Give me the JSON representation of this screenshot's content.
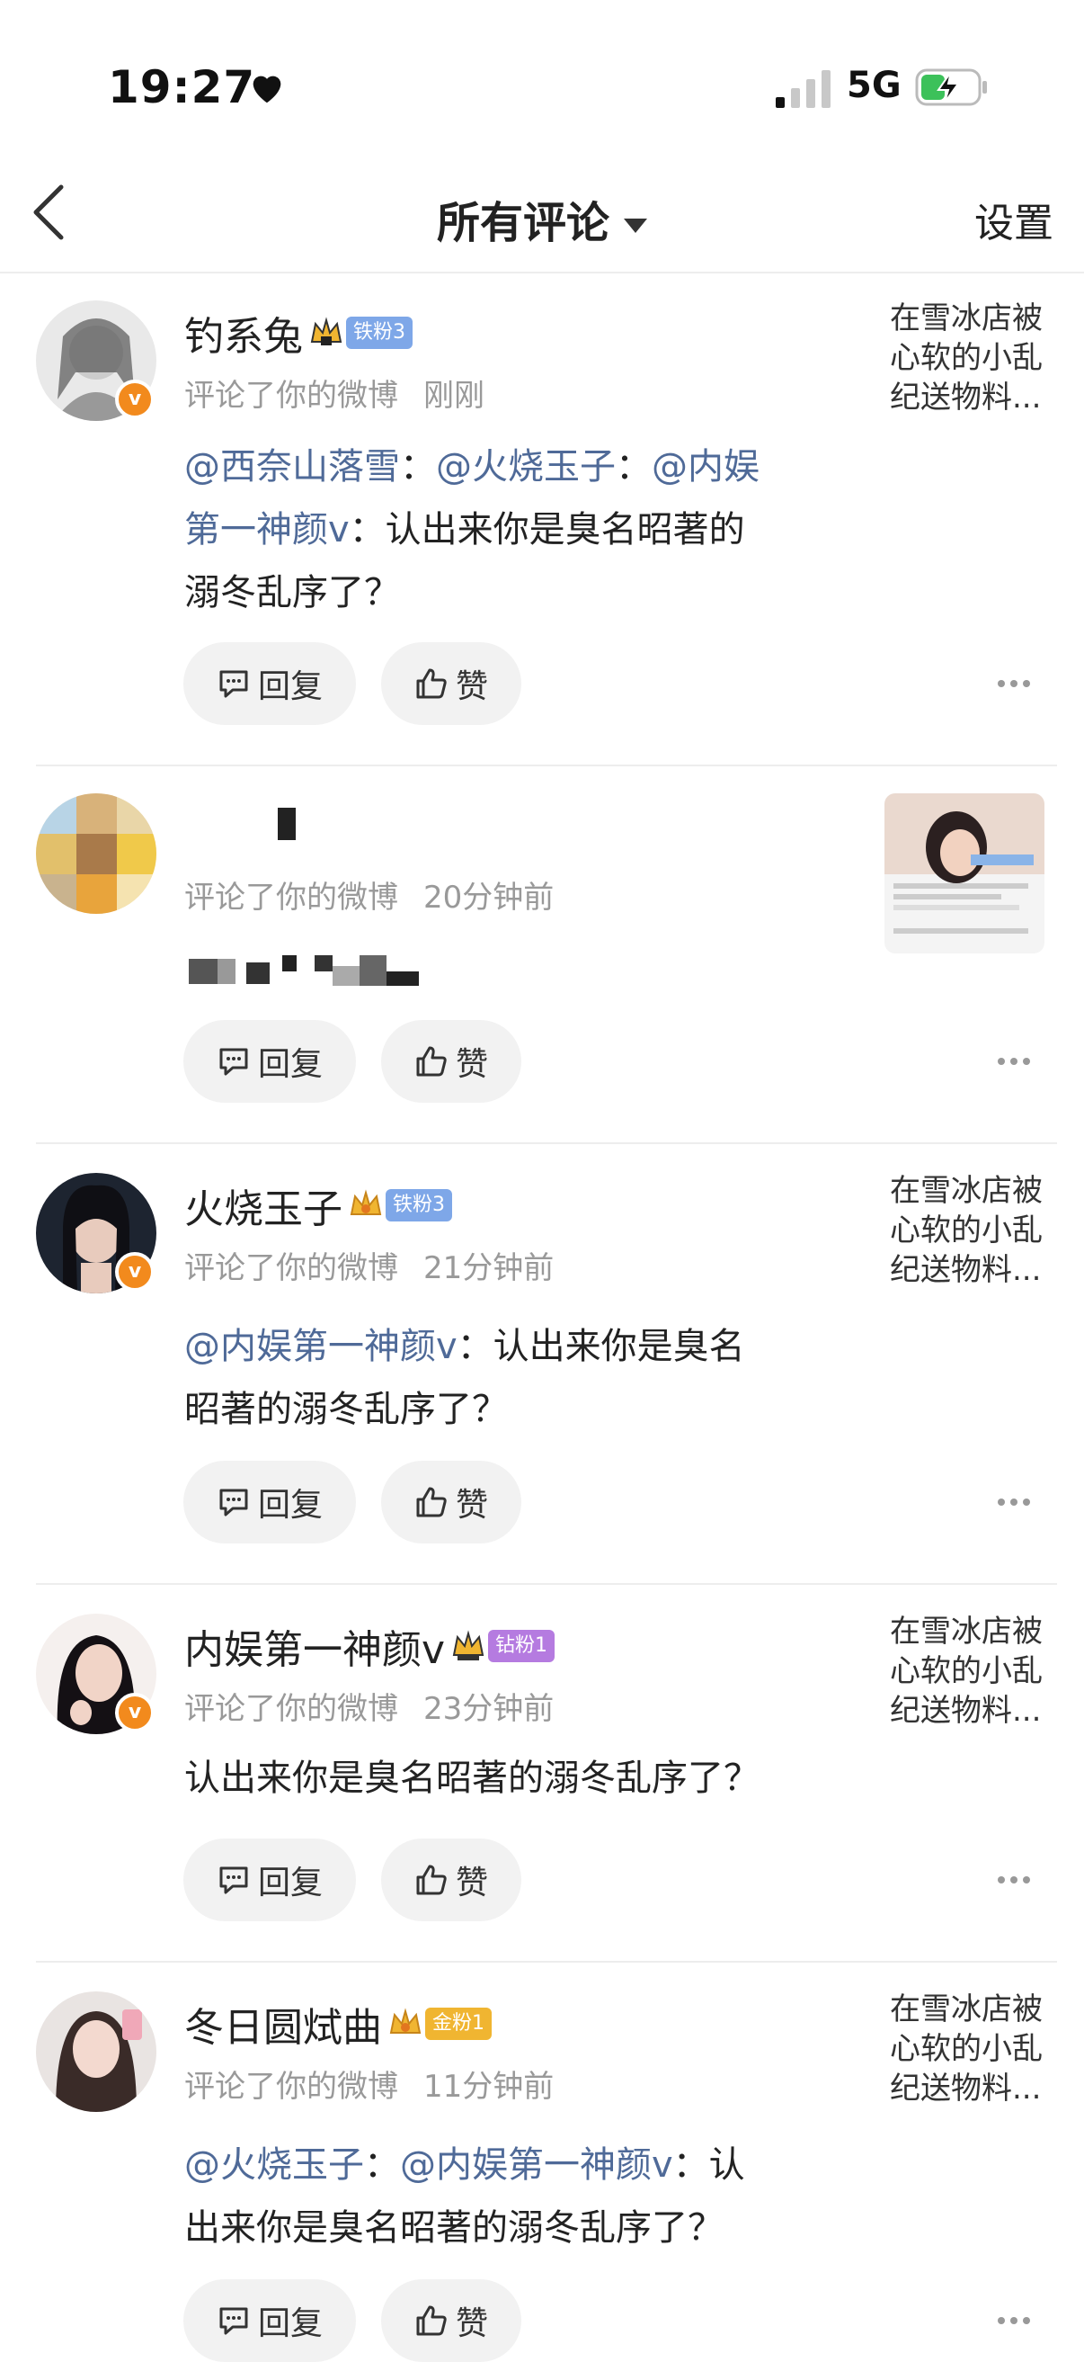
{
  "status_bar": {
    "time": "19:27",
    "network": "5G"
  },
  "nav": {
    "title": "所有评论",
    "settings": "设置"
  },
  "actions": {
    "reply": "回复",
    "like": "赞"
  },
  "comments": [
    {
      "name": "钓系兔",
      "fan_badge": "铁粉3",
      "fan_color": "#7ea7e8",
      "action": "评论了你的微博",
      "time": "刚刚",
      "body_parts": [
        "@西奈山落雪",
        "：",
        "@火烧玉子",
        "：",
        "@内娱",
        "第一神颜v",
        "：认出来你是臭名昭著的",
        "溺冬乱序了？"
      ],
      "preview": [
        "在雪冰店被",
        "心软的小乱",
        "纪送物料..."
      ]
    },
    {
      "name": "",
      "action": "评论了你的微博",
      "time": "20分钟前",
      "body_parts": []
    },
    {
      "name": "火烧玉子",
      "fan_badge": "铁粉3",
      "fan_color": "#7ea7e8",
      "action": "评论了你的微博",
      "time": "21分钟前",
      "body_parts": [
        "@内娱第一神颜v",
        "：认出来你是臭名",
        "昭著的溺冬乱序了？"
      ],
      "preview": [
        "在雪冰店被",
        "心软的小乱",
        "纪送物料..."
      ]
    },
    {
      "name": "内娱第一神颜v",
      "fan_badge": "钻粉1",
      "fan_color": "#b57be0",
      "action": "评论了你的微博",
      "time": "23分钟前",
      "body_parts": [
        "认出来你是臭名昭著的溺冬乱序了？"
      ],
      "preview": [
        "在雪冰店被",
        "心软的小乱",
        "纪送物料..."
      ]
    },
    {
      "name": "冬日圆烒曲",
      "fan_badge": "金粉1",
      "fan_color": "#f0b531",
      "action": "评论了你的微博",
      "time": "11分钟前",
      "body_parts": [
        "@火烧玉子",
        "：",
        "@内娱第一神颜v",
        "：认",
        "出来你是臭名昭著的溺冬乱序了？"
      ],
      "preview": [
        "在雪冰店被",
        "心软的小乱",
        "纪送物料..."
      ]
    }
  ],
  "colors": {
    "mention": "#4f6a98",
    "verified": "#f28a1d",
    "button_bg": "#f2f2f2"
  }
}
